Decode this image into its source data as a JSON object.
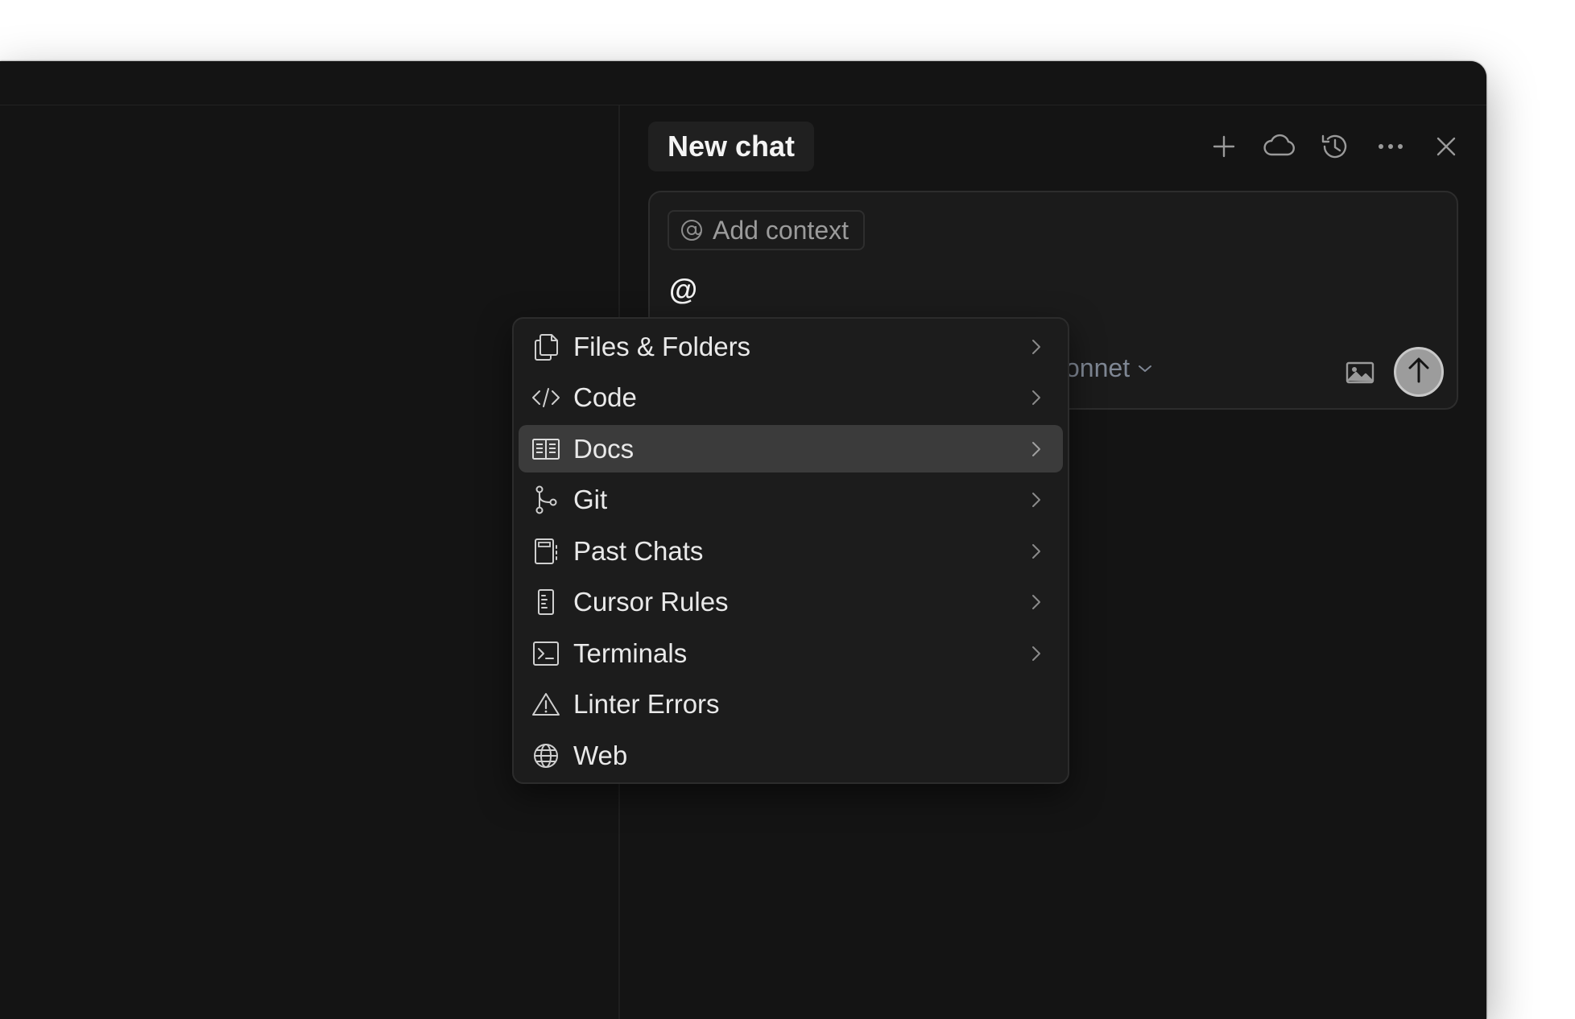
{
  "chat": {
    "tab_title": "New chat",
    "actions": [
      {
        "icon": "plus-icon"
      },
      {
        "icon": "cloud-icon"
      },
      {
        "icon": "history-icon"
      },
      {
        "icon": "more-icon"
      },
      {
        "icon": "close-icon"
      }
    ]
  },
  "composer": {
    "add_context_label": "Add context",
    "input_value": "@",
    "model_label": "sonnet",
    "icons": {
      "attach_image": "image-icon",
      "send": "arrow-up-icon"
    }
  },
  "context_menu": {
    "items": [
      {
        "label": "Files & Folders",
        "icon": "files-icon",
        "has_submenu": true
      },
      {
        "label": "Code",
        "icon": "code-icon",
        "has_submenu": true
      },
      {
        "label": "Docs",
        "icon": "book-icon",
        "has_submenu": true,
        "highlighted": true
      },
      {
        "label": "Git",
        "icon": "git-branch-icon",
        "has_submenu": true
      },
      {
        "label": "Past Chats",
        "icon": "chat-history-icon",
        "has_submenu": true
      },
      {
        "label": "Cursor Rules",
        "icon": "rules-icon",
        "has_submenu": true
      },
      {
        "label": "Terminals",
        "icon": "terminal-icon",
        "has_submenu": true
      },
      {
        "label": "Linter Errors",
        "icon": "warning-icon",
        "has_submenu": false
      },
      {
        "label": "Web",
        "icon": "globe-icon",
        "has_submenu": false
      }
    ]
  },
  "colors": {
    "window_bg": "#141414",
    "panel_bg": "#1c1c1c",
    "highlight_bg": "#3b3b3b",
    "text": "#e9e9e9",
    "muted_text": "#9b9b9b",
    "model_text": "#7f8794"
  }
}
